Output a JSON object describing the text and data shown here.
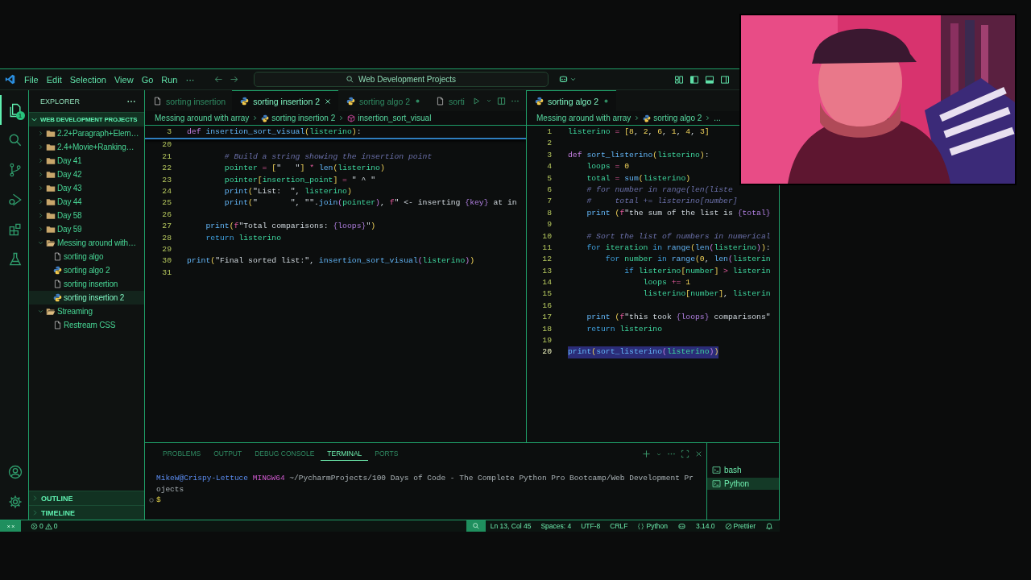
{
  "title_bar": {
    "menu": [
      "File",
      "Edit",
      "Selection",
      "View",
      "Go",
      "Run",
      "···"
    ],
    "search": {
      "value": "Web Development Projects"
    }
  },
  "activity_bar": {
    "items": [
      {
        "kind": "explorer",
        "selected": true,
        "badge": "1"
      },
      {
        "kind": "search",
        "selected": false
      },
      {
        "kind": "source-control",
        "selected": false
      },
      {
        "kind": "run-debug",
        "selected": false
      },
      {
        "kind": "extensions",
        "selected": false
      },
      {
        "kind": "testing",
        "selected": false
      }
    ],
    "bottom": [
      {
        "kind": "account"
      },
      {
        "kind": "settings"
      }
    ]
  },
  "sidebar": {
    "title": "EXPLORER",
    "section": {
      "label": "WEB DEVELOPMENT PROJECTS",
      "expanded": true
    },
    "tree": [
      {
        "label": "2.2+Paragraph+Elem…",
        "kind": "folder",
        "expanded": false,
        "selected": false
      },
      {
        "label": "2.4+Movie+Ranking…",
        "kind": "folder",
        "expanded": false,
        "selected": false
      },
      {
        "label": "Day 41",
        "kind": "folder",
        "expanded": false,
        "selected": false
      },
      {
        "label": "Day 42",
        "kind": "folder",
        "expanded": false,
        "selected": false
      },
      {
        "label": "Day 43",
        "kind": "folder",
        "expanded": false,
        "selected": false
      },
      {
        "label": "Day 44",
        "kind": "folder",
        "expanded": false,
        "selected": false
      },
      {
        "label": "Day 58",
        "kind": "folder",
        "expanded": false,
        "selected": false
      },
      {
        "label": "Day 59",
        "kind": "folder",
        "expanded": false,
        "selected": false
      },
      {
        "label": "Messing around with…",
        "kind": "folder",
        "expanded": true,
        "selected": false,
        "children": [
          {
            "label": "sorting algo",
            "kind": "file",
            "selected": false
          },
          {
            "label": "sorting algo 2",
            "kind": "python",
            "selected": false
          },
          {
            "label": "sorting insertion",
            "kind": "file",
            "selected": false
          },
          {
            "label": "sorting insertion 2",
            "kind": "python",
            "selected": true
          }
        ]
      },
      {
        "label": "Streaming",
        "kind": "folder",
        "expanded": true,
        "selected": false,
        "children": [
          {
            "label": "Restream CSS",
            "kind": "file",
            "selected": false
          }
        ]
      }
    ],
    "collapsed_sections": [
      {
        "label": "OUTLINE",
        "expanded": false
      },
      {
        "label": "TIMELINE",
        "expanded": false
      }
    ]
  },
  "editor_groups": [
    {
      "toolbar": true,
      "tabs": [
        {
          "label": "sorting insertion",
          "kind": "file",
          "selected": false,
          "modified": false
        },
        {
          "label": "sorting insertion 2",
          "kind": "python",
          "selected": true,
          "modified": false
        },
        {
          "label": "sorting algo 2",
          "kind": "python",
          "selected": false,
          "modified": true
        },
        {
          "label": "sorti",
          "kind": "file",
          "selected": false,
          "modified": false
        }
      ],
      "breadcrumbs": [
        {
          "label": "Messing around with array",
          "kind": "folder"
        },
        {
          "label": "sorting insertion 2",
          "kind": "python"
        },
        {
          "label": "insertion_sort_visual",
          "kind": "method"
        }
      ],
      "sticky_line": {
        "number": "3",
        "tokens": [
          {
            "kind": "kw",
            "text": "def "
          },
          {
            "kind": "fn",
            "text": "insertion_sort_visual"
          },
          {
            "kind": "br",
            "text": "("
          },
          {
            "kind": "var",
            "text": "listerino"
          },
          {
            "kind": "br",
            "text": ")"
          },
          {
            "kind": "pl",
            "text": ":"
          }
        ]
      },
      "lines": [
        {
          "number": "20"
        },
        {
          "number": "21",
          "tokens": [
            {
              "kind": "cmt",
              "text": "        # Build a string showing the insertion point"
            }
          ]
        },
        {
          "number": "22",
          "tokens": [
            {
              "kind": "var",
              "text": "        pointer"
            },
            {
              "kind": "op",
              "text": " = "
            },
            {
              "kind": "br",
              "text": "["
            },
            {
              "kind": "str",
              "text": "\"   \""
            },
            {
              "kind": "br",
              "text": "]"
            },
            {
              "kind": "op",
              "text": " * "
            },
            {
              "kind": "fn",
              "text": "len"
            },
            {
              "kind": "br",
              "text": "("
            },
            {
              "kind": "var",
              "text": "listerino"
            },
            {
              "kind": "br",
              "text": ")"
            }
          ]
        },
        {
          "number": "23",
          "tokens": [
            {
              "kind": "var",
              "text": "        pointer"
            },
            {
              "kind": "br",
              "text": "["
            },
            {
              "kind": "var",
              "text": "insertion_point"
            },
            {
              "kind": "br",
              "text": "]"
            },
            {
              "kind": "op",
              "text": " = "
            },
            {
              "kind": "str",
              "text": "\" ^ \""
            }
          ]
        },
        {
          "number": "24",
          "tokens": [
            {
              "kind": "fn",
              "text": "        print"
            },
            {
              "kind": "br",
              "text": "("
            },
            {
              "kind": "str",
              "text": "\"List:  \""
            },
            {
              "kind": "pl",
              "text": ", "
            },
            {
              "kind": "var",
              "text": "listerino"
            },
            {
              "kind": "br",
              "text": ")"
            }
          ]
        },
        {
          "number": "25",
          "tokens": [
            {
              "kind": "fn",
              "text": "        print"
            },
            {
              "kind": "br",
              "text": "("
            },
            {
              "kind": "str",
              "text": "\"       \""
            },
            {
              "kind": "pl",
              "text": ", "
            },
            {
              "kind": "str",
              "text": "\"\""
            },
            {
              "kind": "pl",
              "text": "."
            },
            {
              "kind": "fn",
              "text": "join"
            },
            {
              "kind": "br2",
              "text": "("
            },
            {
              "kind": "var",
              "text": "pointer"
            },
            {
              "kind": "br2",
              "text": ")"
            },
            {
              "kind": "pl",
              "text": ", "
            },
            {
              "kind": "op",
              "text": "f"
            },
            {
              "kind": "str",
              "text": "\" <- inserting "
            },
            {
              "kind": "fmt",
              "text": "{key}"
            },
            {
              "kind": "str",
              "text": " at in"
            }
          ]
        },
        {
          "number": "26"
        },
        {
          "number": "27",
          "tokens": [
            {
              "kind": "fn",
              "text": "    print"
            },
            {
              "kind": "br",
              "text": "("
            },
            {
              "kind": "op",
              "text": "f"
            },
            {
              "kind": "str",
              "text": "\"Total comparisons: "
            },
            {
              "kind": "fmt",
              "text": "{loops}"
            },
            {
              "kind": "str",
              "text": "\""
            },
            {
              "kind": "br",
              "text": ")"
            }
          ]
        },
        {
          "number": "28",
          "tokens": [
            {
              "kind": "ctl",
              "text": "    return "
            },
            {
              "kind": "var",
              "text": "listerino"
            }
          ]
        },
        {
          "number": "29"
        },
        {
          "number": "30",
          "tokens": [
            {
              "kind": "fn",
              "text": "print"
            },
            {
              "kind": "br",
              "text": "("
            },
            {
              "kind": "str",
              "text": "\"Final sorted list:\""
            },
            {
              "kind": "pl",
              "text": ", "
            },
            {
              "kind": "fn",
              "text": "insertion_sort_visual"
            },
            {
              "kind": "br2",
              "text": "("
            },
            {
              "kind": "var",
              "text": "listerino"
            },
            {
              "kind": "br2",
              "text": ")"
            },
            {
              "kind": "br",
              "text": ")"
            }
          ]
        },
        {
          "number": "31"
        }
      ]
    },
    {
      "tabs": [
        {
          "label": "sorting algo 2",
          "kind": "python",
          "selected": true,
          "modified": true
        }
      ],
      "breadcrumbs": [
        {
          "label": "Messing around with array",
          "kind": "folder"
        },
        {
          "label": "sorting algo 2",
          "kind": "python"
        },
        {
          "label": "...",
          "kind": "more"
        }
      ],
      "lines": [
        {
          "number": "1",
          "selected": false,
          "tokens": [
            {
              "kind": "var",
              "text": "listerino"
            },
            {
              "kind": "op",
              "text": " = "
            },
            {
              "kind": "br",
              "text": "["
            },
            {
              "kind": "num",
              "text": "8"
            },
            {
              "kind": "pl",
              "text": ", "
            },
            {
              "kind": "num",
              "text": "2"
            },
            {
              "kind": "pl",
              "text": ", "
            },
            {
              "kind": "num",
              "text": "6"
            },
            {
              "kind": "pl",
              "text": ", "
            },
            {
              "kind": "num",
              "text": "1"
            },
            {
              "kind": "pl",
              "text": ", "
            },
            {
              "kind": "num",
              "text": "4"
            },
            {
              "kind": "pl",
              "text": ", "
            },
            {
              "kind": "num",
              "text": "3"
            },
            {
              "kind": "br",
              "text": "]"
            }
          ]
        },
        {
          "number": "2",
          "selected": false
        },
        {
          "number": "3",
          "selected": false,
          "tokens": [
            {
              "kind": "kw",
              "text": "def "
            },
            {
              "kind": "fn",
              "text": "sort_listerino"
            },
            {
              "kind": "br",
              "text": "("
            },
            {
              "kind": "var",
              "text": "listerino"
            },
            {
              "kind": "br",
              "text": ")"
            },
            {
              "kind": "pl",
              "text": ":"
            }
          ]
        },
        {
          "number": "4",
          "selected": false,
          "tokens": [
            {
              "kind": "var",
              "text": "    loops"
            },
            {
              "kind": "op",
              "text": " = "
            },
            {
              "kind": "num",
              "text": "0"
            }
          ]
        },
        {
          "number": "5",
          "selected": false,
          "tokens": [
            {
              "kind": "var",
              "text": "    total"
            },
            {
              "kind": "op",
              "text": " = "
            },
            {
              "kind": "fn",
              "text": "sum"
            },
            {
              "kind": "br",
              "text": "("
            },
            {
              "kind": "var",
              "text": "listerino"
            },
            {
              "kind": "br",
              "text": ")"
            }
          ]
        },
        {
          "number": "6",
          "selected": false,
          "tokens": [
            {
              "kind": "cmt",
              "text": "    # for number in range(len(liste"
            }
          ]
        },
        {
          "number": "7",
          "selected": false,
          "tokens": [
            {
              "kind": "cmt",
              "text": "    #     total += listerino[number]"
            }
          ]
        },
        {
          "number": "8",
          "selected": false,
          "tokens": [
            {
              "kind": "fn",
              "text": "    print "
            },
            {
              "kind": "br",
              "text": "("
            },
            {
              "kind": "op",
              "text": "f"
            },
            {
              "kind": "str",
              "text": "\"the sum of the list is "
            },
            {
              "kind": "fmt",
              "text": "{total}"
            }
          ]
        },
        {
          "number": "9",
          "selected": false
        },
        {
          "number": "10",
          "selected": false,
          "tokens": [
            {
              "kind": "cmt",
              "text": "    # Sort the list of numbers in numerical"
            }
          ]
        },
        {
          "number": "11",
          "selected": false,
          "tokens": [
            {
              "kind": "ctl",
              "text": "    for "
            },
            {
              "kind": "var",
              "text": "iteration"
            },
            {
              "kind": "ctl",
              "text": " in "
            },
            {
              "kind": "fn",
              "text": "range"
            },
            {
              "kind": "br",
              "text": "("
            },
            {
              "kind": "fn",
              "text": "len"
            },
            {
              "kind": "br2",
              "text": "("
            },
            {
              "kind": "var",
              "text": "listerino"
            },
            {
              "kind": "br2",
              "text": ")"
            },
            {
              "kind": "br",
              "text": ")"
            },
            {
              "kind": "pl",
              "text": ":"
            }
          ]
        },
        {
          "number": "12",
          "selected": false,
          "tokens": [
            {
              "kind": "ctl",
              "text": "        for "
            },
            {
              "kind": "var",
              "text": "number"
            },
            {
              "kind": "ctl",
              "text": " in "
            },
            {
              "kind": "fn",
              "text": "range"
            },
            {
              "kind": "br",
              "text": "("
            },
            {
              "kind": "num",
              "text": "0"
            },
            {
              "kind": "pl",
              "text": ", "
            },
            {
              "kind": "fn",
              "text": "len"
            },
            {
              "kind": "br2",
              "text": "("
            },
            {
              "kind": "var",
              "text": "listerin"
            }
          ]
        },
        {
          "number": "13",
          "selected": false,
          "tokens": [
            {
              "kind": "ctl",
              "text": "            if "
            },
            {
              "kind": "var",
              "text": "listerino"
            },
            {
              "kind": "br",
              "text": "["
            },
            {
              "kind": "var",
              "text": "number"
            },
            {
              "kind": "br",
              "text": "]"
            },
            {
              "kind": "op",
              "text": " > "
            },
            {
              "kind": "var",
              "text": "listerin"
            }
          ]
        },
        {
          "number": "14",
          "selected": false,
          "tokens": [
            {
              "kind": "var",
              "text": "                loops"
            },
            {
              "kind": "op",
              "text": " += "
            },
            {
              "kind": "num",
              "text": "1"
            }
          ]
        },
        {
          "number": "15",
          "selected": false,
          "tokens": [
            {
              "kind": "var",
              "text": "                listerino"
            },
            {
              "kind": "br",
              "text": "["
            },
            {
              "kind": "var",
              "text": "number"
            },
            {
              "kind": "br",
              "text": "]"
            },
            {
              "kind": "pl",
              "text": ", "
            },
            {
              "kind": "var",
              "text": "listerin"
            }
          ]
        },
        {
          "number": "16",
          "selected": false
        },
        {
          "number": "17",
          "selected": false,
          "tokens": [
            {
              "kind": "fn",
              "text": "    print "
            },
            {
              "kind": "br",
              "text": "("
            },
            {
              "kind": "op",
              "text": "f"
            },
            {
              "kind": "str",
              "text": "\"this took "
            },
            {
              "kind": "fmt",
              "text": "{loops}"
            },
            {
              "kind": "str",
              "text": " comparisons\""
            }
          ]
        },
        {
          "number": "18",
          "selected": false,
          "tokens": [
            {
              "kind": "ctl",
              "text": "    return "
            },
            {
              "kind": "var",
              "text": "listerino"
            }
          ]
        },
        {
          "number": "19",
          "selected": false
        },
        {
          "number": "20",
          "selected": true,
          "tokens": [
            {
              "kind": "fn",
              "text": "print"
            },
            {
              "kind": "br",
              "text": "("
            },
            {
              "kind": "fn",
              "text": "sort_listerino"
            },
            {
              "kind": "br2",
              "text": "("
            },
            {
              "kind": "var",
              "text": "listerino"
            },
            {
              "kind": "br2",
              "text": ")"
            },
            {
              "kind": "br",
              "text": ")"
            }
          ]
        }
      ]
    }
  ],
  "panel": {
    "tabs": [
      {
        "label": "PROBLEMS",
        "selected": false
      },
      {
        "label": "OUTPUT",
        "selected": false
      },
      {
        "label": "DEBUG CONSOLE",
        "selected": false
      },
      {
        "label": "TERMINAL",
        "selected": true
      },
      {
        "label": "PORTS",
        "selected": false
      }
    ],
    "terminal_lines": [
      {
        "kind": "output",
        "segments": [
          {
            "kind": "user",
            "text": "MikeW@Crispy-Lettuce"
          },
          {
            "kind": "host",
            "text": " MINGW64"
          },
          {
            "kind": "plain",
            "text": " ~/PycharmProjects/100 Days of Code - The Complete Python Pro Bootcamp/Web Development Pr"
          }
        ]
      },
      {
        "kind": "output",
        "segments": [
          {
            "kind": "plain",
            "text": "ojects"
          }
        ]
      },
      {
        "kind": "prompt",
        "segments": [
          {
            "kind": "prompt",
            "text": "$"
          }
        ]
      }
    ],
    "terminals": [
      {
        "label": "bash",
        "selected": false
      },
      {
        "label": "Python",
        "selected": true
      }
    ]
  },
  "status_bar": {
    "left": [
      {
        "kind": "remote"
      },
      {
        "kind": "problems",
        "errors": "0",
        "warnings": "0"
      }
    ],
    "right": [
      {
        "kind": "zoom"
      },
      {
        "kind": "text",
        "label": "Ln 13, Col 45"
      },
      {
        "kind": "text",
        "label": "Spaces: 4"
      },
      {
        "kind": "text",
        "label": "UTF-8"
      },
      {
        "kind": "text",
        "label": "CRLF"
      },
      {
        "kind": "language",
        "label": "Python"
      },
      {
        "kind": "copilot"
      },
      {
        "kind": "text",
        "label": "3.14.0"
      },
      {
        "kind": "prettier",
        "label": "Prettier"
      },
      {
        "kind": "bell"
      }
    ]
  }
}
